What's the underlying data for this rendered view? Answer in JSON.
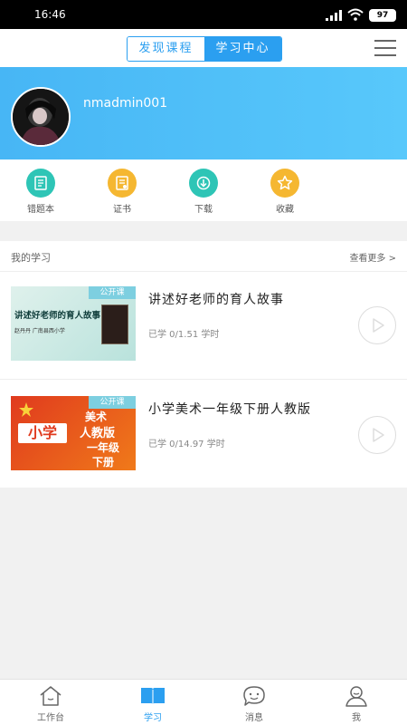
{
  "status": {
    "time": "16:46",
    "battery": "97"
  },
  "nav": {
    "discover_label": "发现课程",
    "center_label": "学习中心"
  },
  "user": {
    "name": "nmadmin001"
  },
  "quick_actions": [
    {
      "label": "错题本",
      "icon": "notebook-icon",
      "color": "#2ec5b6"
    },
    {
      "label": "证书",
      "icon": "certificate-icon",
      "color": "#f5b731"
    },
    {
      "label": "下载",
      "icon": "download-icon",
      "color": "#2ec5b6"
    },
    {
      "label": "收藏",
      "icon": "star-icon",
      "color": "#f5b731"
    }
  ],
  "my_learning": {
    "title": "我的学习",
    "more": "查看更多 >"
  },
  "courses": [
    {
      "title": "讲述好老师的育人故事",
      "progress": "已学 0/1.51 学时",
      "tag": "公开课",
      "thumb_text": "讲述好老师的育人故事",
      "thumb_sub": "赵丹丹    广南县西小学"
    },
    {
      "title": "小学美术一年级下册人教版",
      "progress": "已学 0/14.97 学时",
      "tag": "公开课",
      "thumb_text1": "小学",
      "thumb_text2": "美术",
      "thumb_text3": "人教版",
      "thumb_text4": "一年级",
      "thumb_text5": "下册"
    }
  ],
  "tabs": [
    {
      "label": "工作台",
      "icon": "home-icon",
      "active": false
    },
    {
      "label": "学习",
      "icon": "book-icon",
      "active": true
    },
    {
      "label": "消息",
      "icon": "message-icon",
      "active": false
    },
    {
      "label": "我",
      "icon": "profile-icon",
      "active": false
    }
  ],
  "colors": {
    "accent": "#2b9ff0",
    "hero_start": "#47b6f5",
    "hero_end": "#58c8fb"
  }
}
